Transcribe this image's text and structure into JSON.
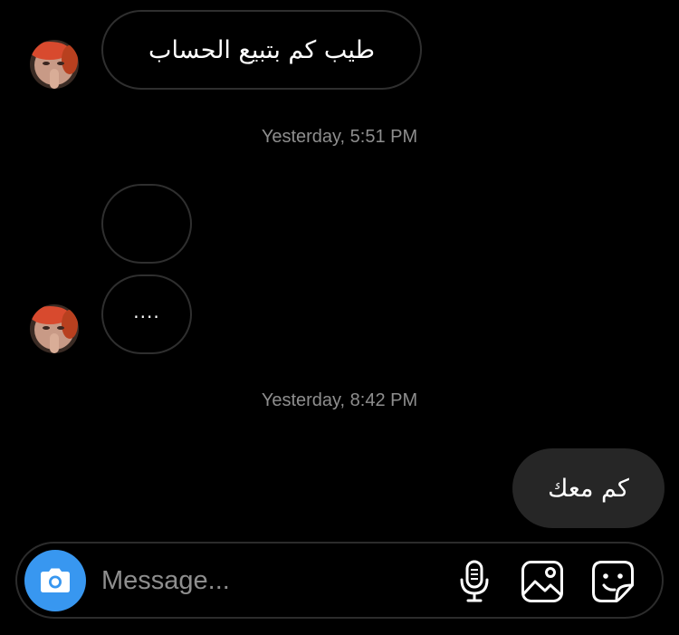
{
  "thread": {
    "messages": [
      {
        "direction": "incoming",
        "text": "طيب كم بتبيع الحساب"
      },
      {
        "direction": "incoming",
        "text": ""
      },
      {
        "direction": "incoming",
        "text": "...."
      },
      {
        "direction": "outgoing",
        "text": "كم معك"
      }
    ],
    "timestamps": [
      "Yesterday, 5:51 PM",
      "Yesterday, 8:42 PM"
    ]
  },
  "composer": {
    "placeholder": "Message...",
    "icons": [
      "camera-icon",
      "microphone-icon",
      "gallery-icon",
      "sticker-icon"
    ]
  },
  "colors": {
    "background": "#000000",
    "outgoing_bubble": "#262626",
    "incoming_border": "#2f2f2f",
    "timestamp": "#8e8e8e",
    "camera_button": "#3897f0"
  }
}
